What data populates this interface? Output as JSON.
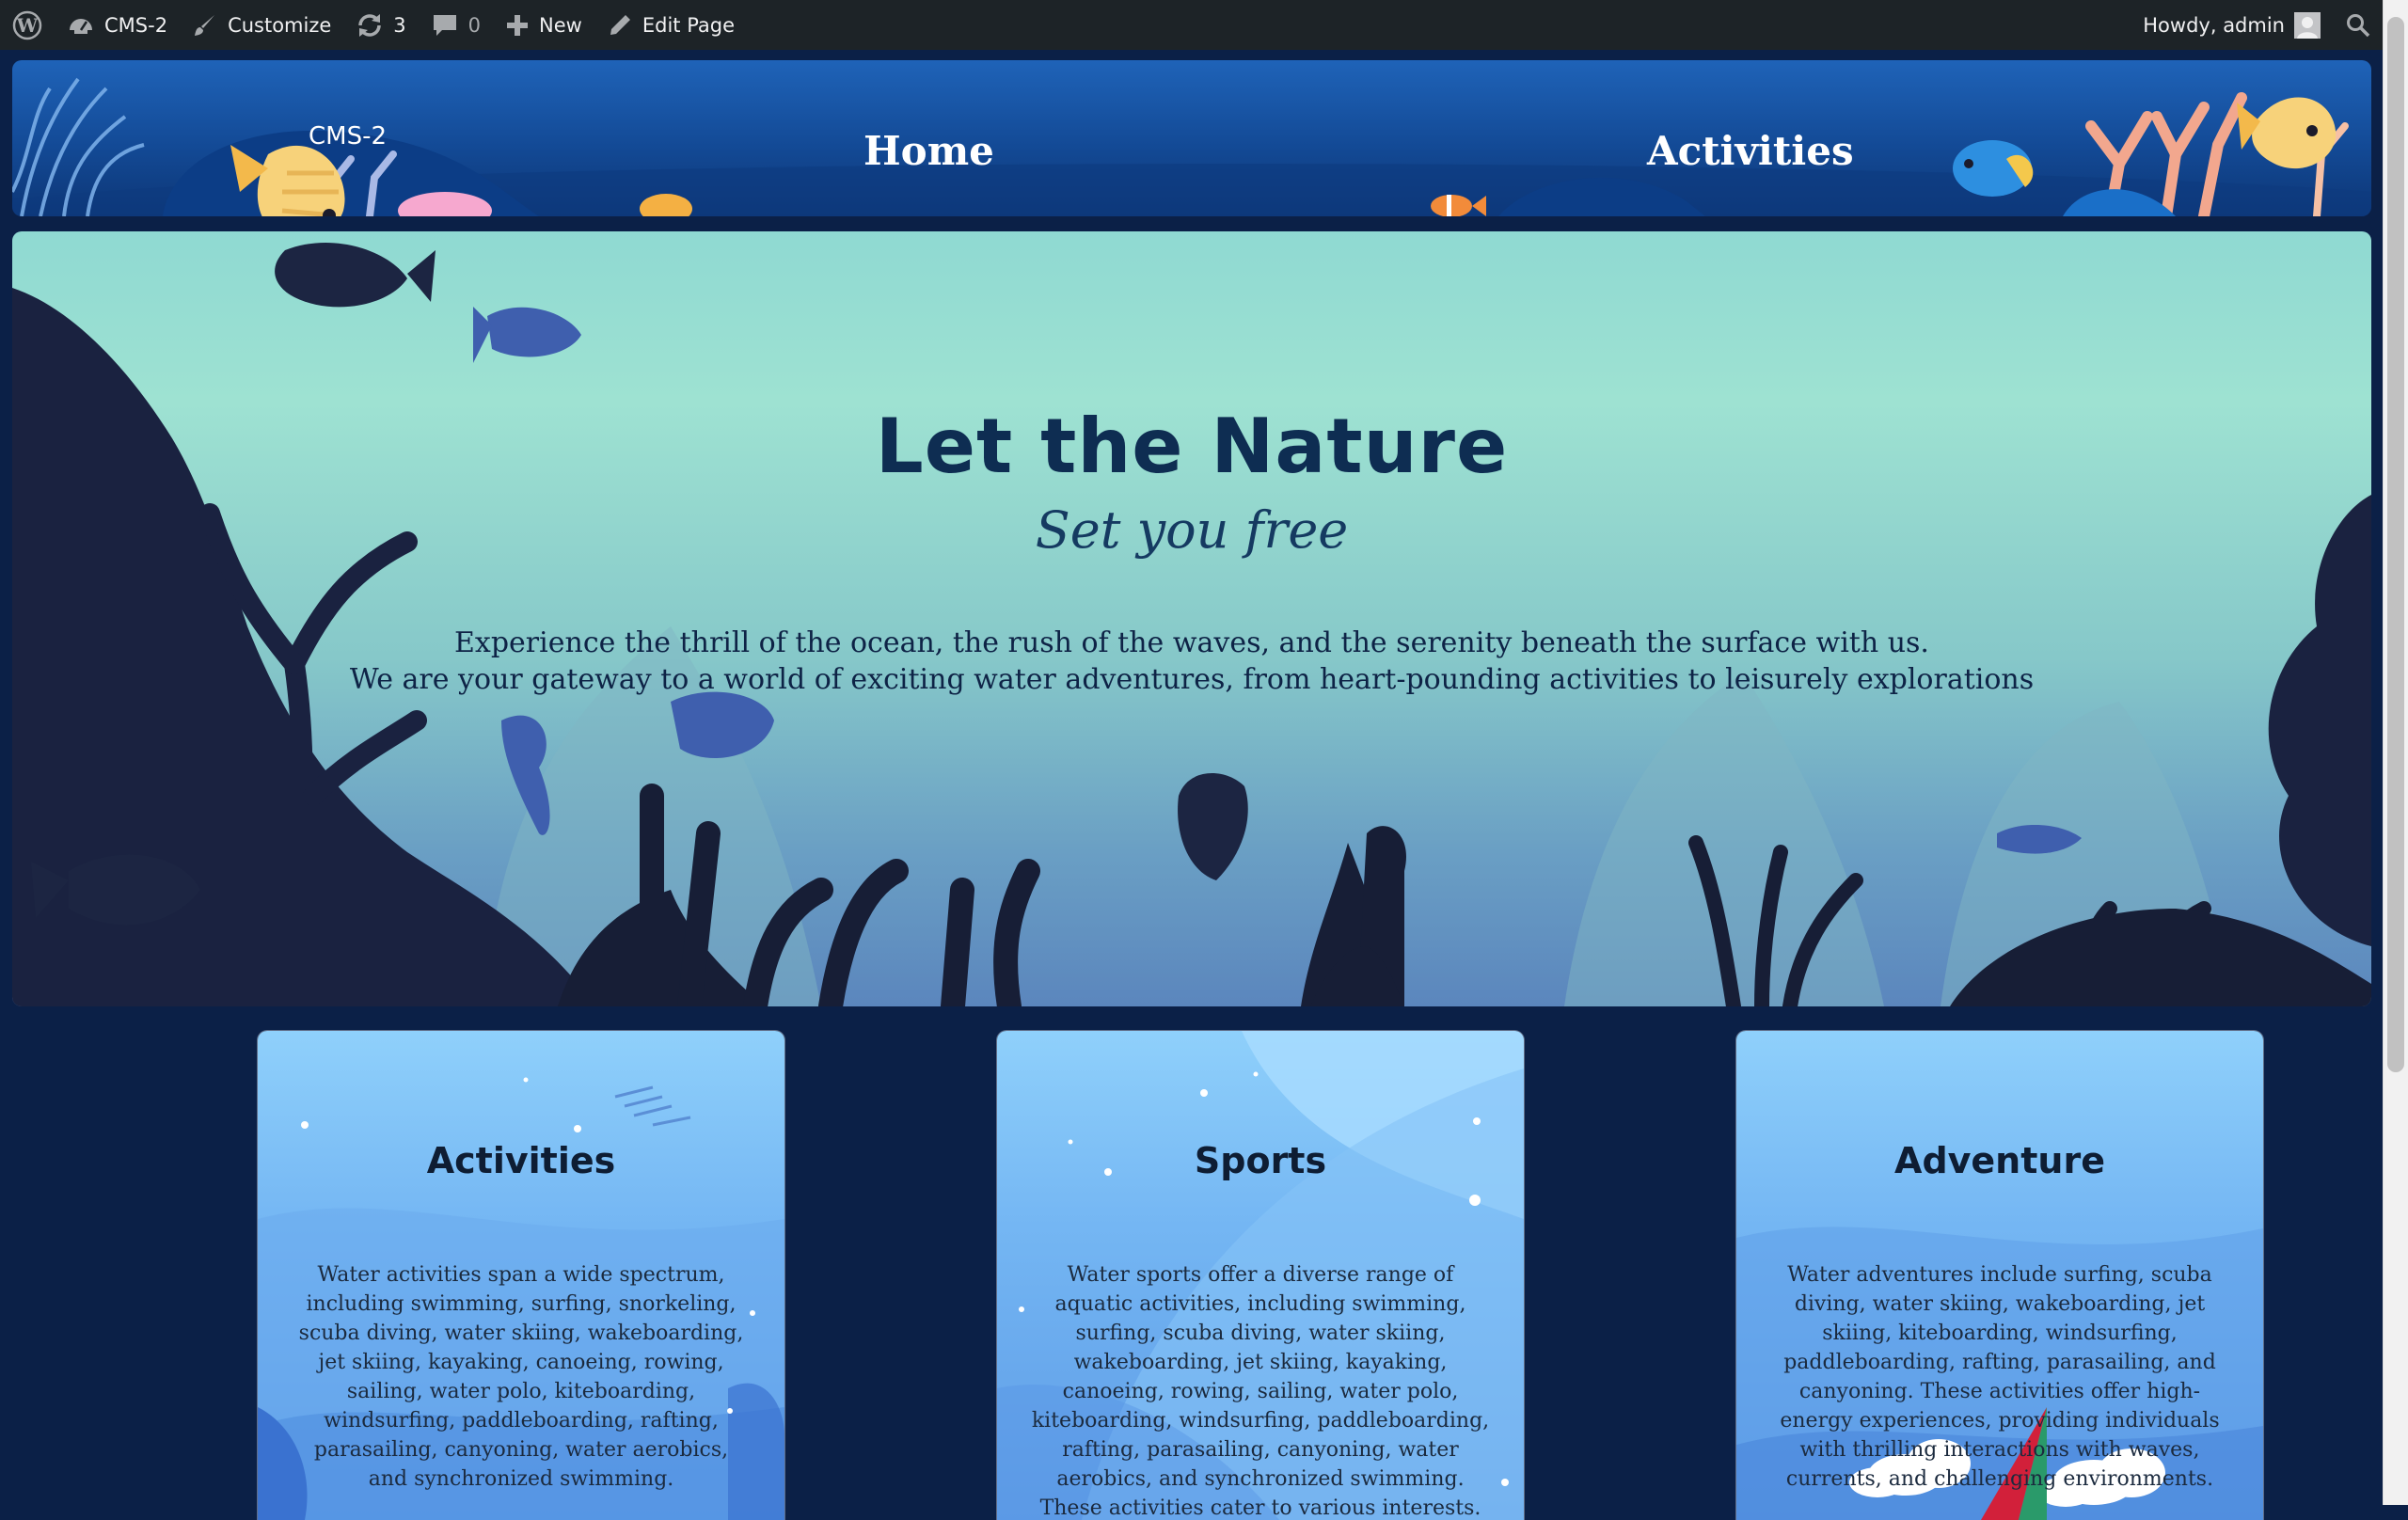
{
  "adminbar": {
    "site_name": "CMS-2",
    "customize_label": "Customize",
    "updates_count": "3",
    "comments_count": "0",
    "new_label": "New",
    "edit_label": "Edit Page",
    "greeting": "Howdy, admin"
  },
  "header": {
    "site_title": "CMS-2",
    "nav": [
      {
        "label": "Home"
      },
      {
        "label": "Activities"
      }
    ]
  },
  "hero": {
    "title": "Let the Nature",
    "subtitle": "Set you free",
    "line1": "Experience the thrill of the ocean, the rush of the waves, and the serenity beneath the surface with us.",
    "line2": "We are your gateway to a world of exciting water adventures, from heart-pounding activities to leisurely explorations"
  },
  "cards": [
    {
      "title": "Activities",
      "text": "Water activities span a wide spectrum, including swimming, surfing, snorkeling, scuba diving, water skiing, wakeboarding, jet skiing, kayaking, canoeing, rowing, sailing, water polo, kiteboarding, windsurfing, paddleboarding, rafting, parasailing, canyoning, water aerobics, and synchronized swimming."
    },
    {
      "title": "Sports",
      "text": "Water sports offer a diverse range of aquatic activities, including swimming, surfing, scuba diving, water skiing, wakeboarding, jet skiing, kayaking, canoeing, rowing, sailing, water polo, kiteboarding, windsurfing, paddleboarding, rafting, parasailing, canyoning, water aerobics, and synchronized swimming. These activities cater to various interests."
    },
    {
      "title": "Adventure",
      "text": "Water adventures include surfing, scuba diving, water skiing, wakeboarding, jet skiing, kiteboarding, windsurfing, paddleboarding, rafting, parasailing, and canyoning. These activities offer high-energy experiences, providing individuals with thrilling interactions with waves, currents, and challenging environments."
    }
  ],
  "icons": {
    "wp_logo": "wordpress-logo-icon",
    "customize": "dashboard-icon",
    "brush": "paintbrush-icon",
    "updates": "updates-icon",
    "comments": "comment-bubble-icon",
    "new": "plus-icon",
    "edit": "pencil-icon",
    "avatar": "avatar-icon",
    "search": "search-icon"
  },
  "colors": {
    "adminbar_bg": "#1d2327",
    "page_bg": "#0b2047",
    "header_blue": "#134a96",
    "hero_teal": "#9ee2d2",
    "heading_navy": "#0e2d52",
    "card_blue": "#74b6f3"
  }
}
